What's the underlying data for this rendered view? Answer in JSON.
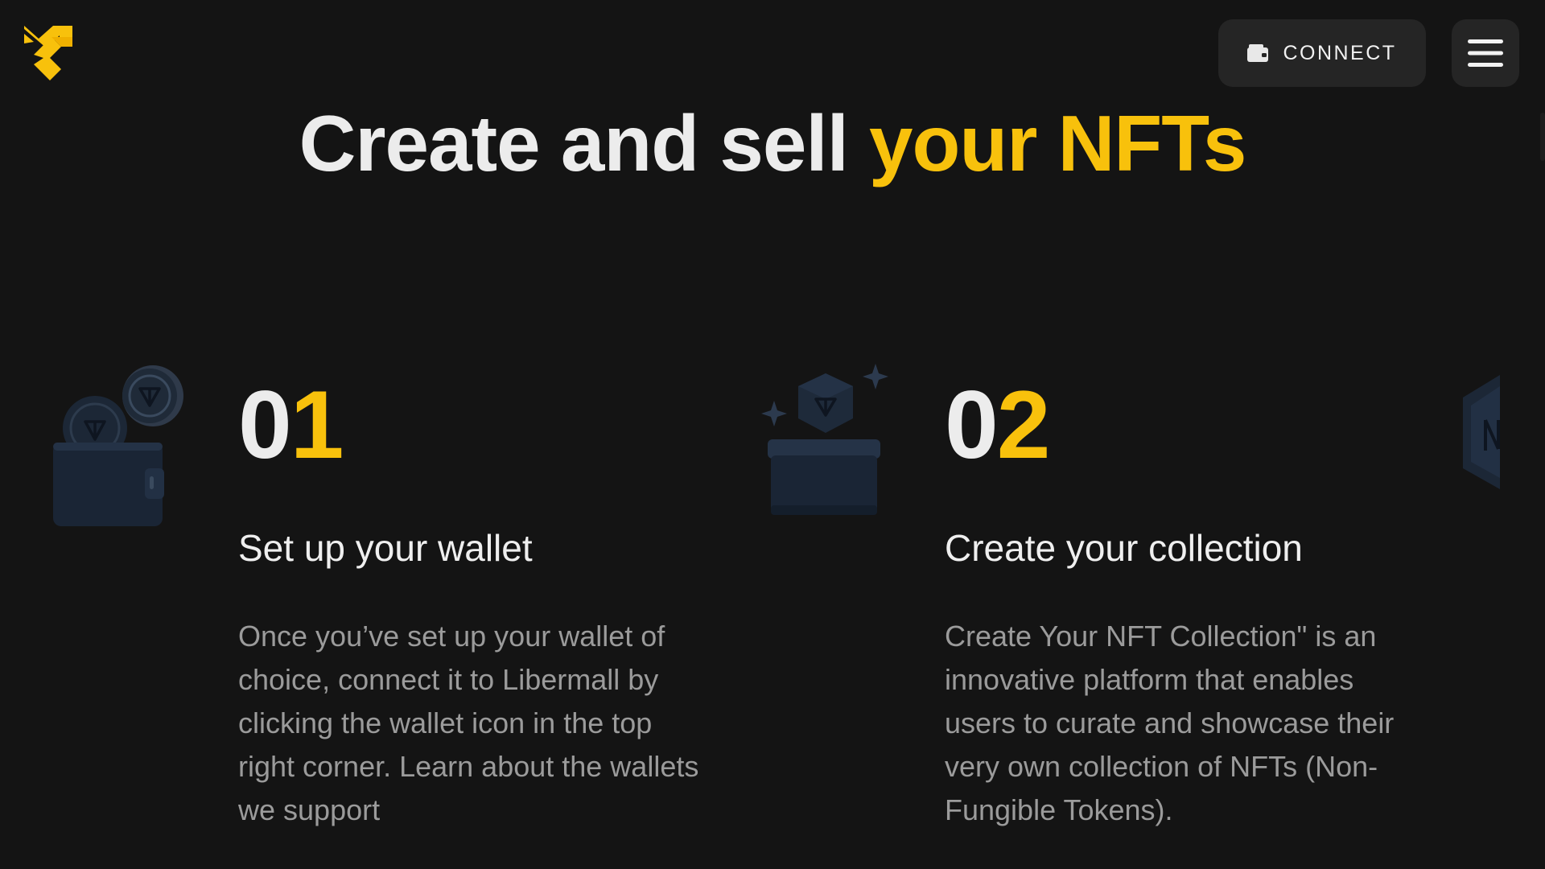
{
  "header": {
    "logo_icon": "libermall-logo-icon",
    "connect_label": "CONNECT",
    "connect_icon": "wallet-icon",
    "menu_icon": "hamburger-menu-icon"
  },
  "hero": {
    "title_plain": "Create and sell ",
    "title_highlight": "your NFTs"
  },
  "steps": [
    {
      "num_first": "0",
      "num_second": "1",
      "title": "Set up your wallet",
      "text": "Once you’ve set up your wallet of choice, connect it to Libermall by clicking the wallet icon in the top right corner. Learn about the wallets we support",
      "illustration": "wallet-coins-icon"
    },
    {
      "num_first": "0",
      "num_second": "2",
      "title": "Create your collection",
      "text": "Create Your NFT Collection\" is an innovative platform that enables users to curate and showcase their very own collection of NFTs (Non-Fungible Tokens).",
      "illustration": "box-collection-icon"
    }
  ],
  "colors": {
    "background": "#141414",
    "accent": "#f8c10c",
    "button_bg": "#252525",
    "body_text": "#9b9b9b"
  }
}
